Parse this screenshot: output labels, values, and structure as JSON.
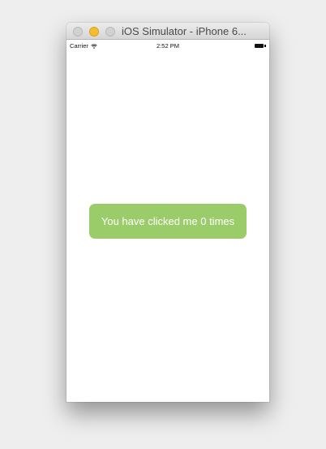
{
  "window": {
    "title": "iOS Simulator - iPhone 6..."
  },
  "status_bar": {
    "carrier": "Carrier",
    "time": "2:52 PM"
  },
  "app": {
    "button_label": "You have clicked me 0 times",
    "button_color": "#9acc6a"
  },
  "icons": {
    "wifi": "wifi-icon",
    "battery": "battery-icon"
  }
}
